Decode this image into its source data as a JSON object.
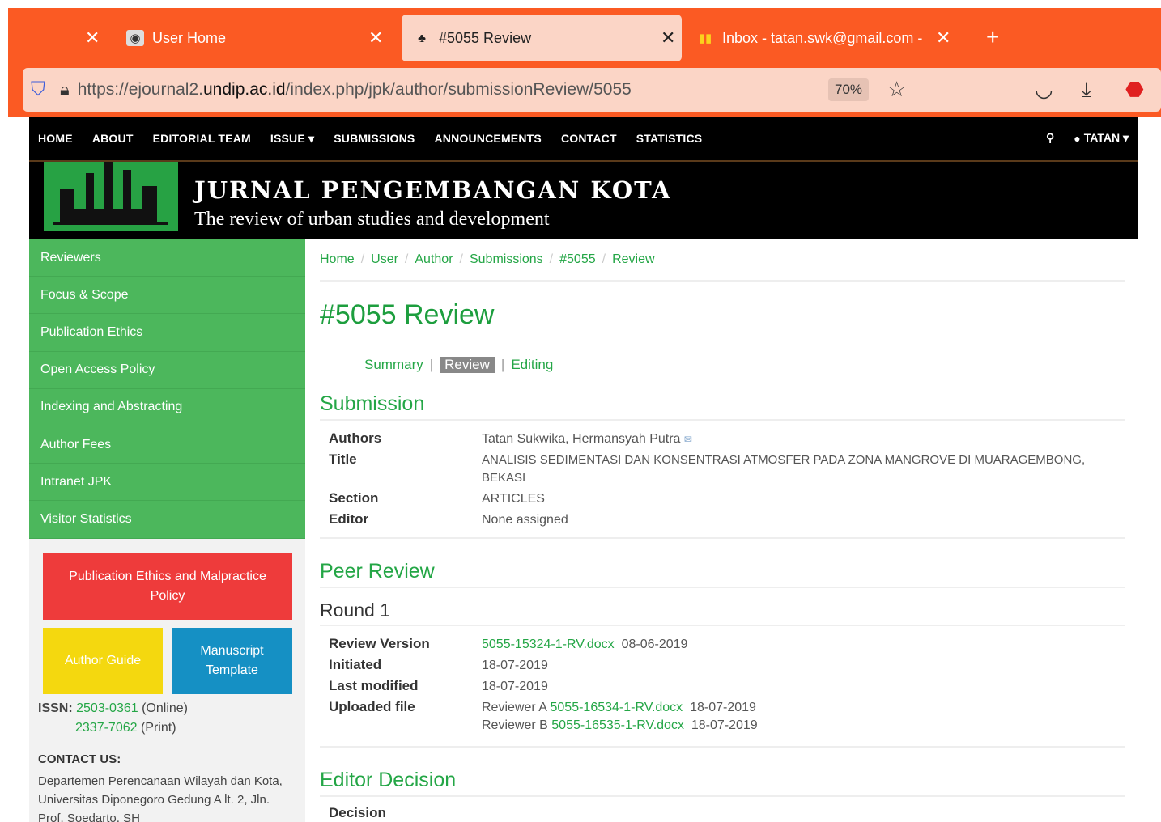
{
  "browser": {
    "tabs": [
      {
        "label": "",
        "active": false
      },
      {
        "label": "User Home",
        "active": false
      },
      {
        "label": "#5055 Review",
        "active": true
      },
      {
        "label": "Inbox - tatan.swk@gmail.com -",
        "active": false
      }
    ],
    "url_prefix": "https://ejournal2.",
    "url_domain": "undip.ac.id",
    "url_path": "/index.php/jpk/author/submissionReview/5055",
    "zoom": "70%"
  },
  "nav": {
    "items": [
      "HOME",
      "ABOUT",
      "EDITORIAL TEAM",
      "ISSUE ▾",
      "SUBMISSIONS",
      "ANNOUNCEMENTS",
      "CONTACT",
      "STATISTICS"
    ],
    "user": "TATAN ▾"
  },
  "banner": {
    "title": "JURNAL PENGEMBANGAN KOTA",
    "subtitle": "The review of urban studies and development"
  },
  "sidebar": {
    "items": [
      "Reviewers",
      "Focus & Scope",
      "Publication Ethics",
      "Open Access Policy",
      "Indexing and Abstracting",
      "Author Fees",
      "Intranet JPK",
      "Visitor Statistics"
    ],
    "btn_ethics": "Publication Ethics and Malpractice Policy",
    "btn_guide": "Author Guide",
    "btn_template": "Manuscript Template",
    "issn_label": "ISSN:",
    "issn_online": "2503-0361",
    "issn_online_suffix": "(Online)",
    "issn_print": "2337-7062",
    "issn_print_suffix": "(Print)",
    "contact_head": "CONTACT US:",
    "contact_text": "Departemen Perencanaan Wilayah dan Kota, Universitas Diponegoro Gedung A lt. 2, Jln. Prof. Soedarto, SH"
  },
  "breadcrumb": [
    "Home",
    "User",
    "Author",
    "Submissions",
    "#5055",
    "Review"
  ],
  "page_title": "#5055 Review",
  "tabs": {
    "summary": "Summary",
    "review": "Review",
    "editing": "Editing"
  },
  "submission": {
    "heading": "Submission",
    "authors_label": "Authors",
    "authors": "Tatan Sukwika, Hermansyah Putra",
    "title_label": "Title",
    "title": "ANALISIS SEDIMENTASI DAN KONSENTRASI ATMOSFER PADA ZONA MANGROVE DI MUARAGEMBONG, BEKASI",
    "section_label": "Section",
    "section": "ARTICLES",
    "editor_label": "Editor",
    "editor": "None assigned"
  },
  "peer_review": {
    "heading": "Peer Review",
    "round": "Round 1",
    "version_label": "Review Version",
    "version_file": "5055-15324-1-RV.docx",
    "version_date": "08-06-2019",
    "initiated_label": "Initiated",
    "initiated": "18-07-2019",
    "modified_label": "Last modified",
    "modified": "18-07-2019",
    "uploaded_label": "Uploaded file",
    "reviewer_a": "Reviewer A",
    "file_a": "5055-16534-1-RV.docx",
    "date_a": "18-07-2019",
    "reviewer_b": "Reviewer B",
    "file_b": "5055-16535-1-RV.docx",
    "date_b": "18-07-2019"
  },
  "editor_decision": {
    "heading": "Editor Decision",
    "decision_label": "Decision"
  }
}
